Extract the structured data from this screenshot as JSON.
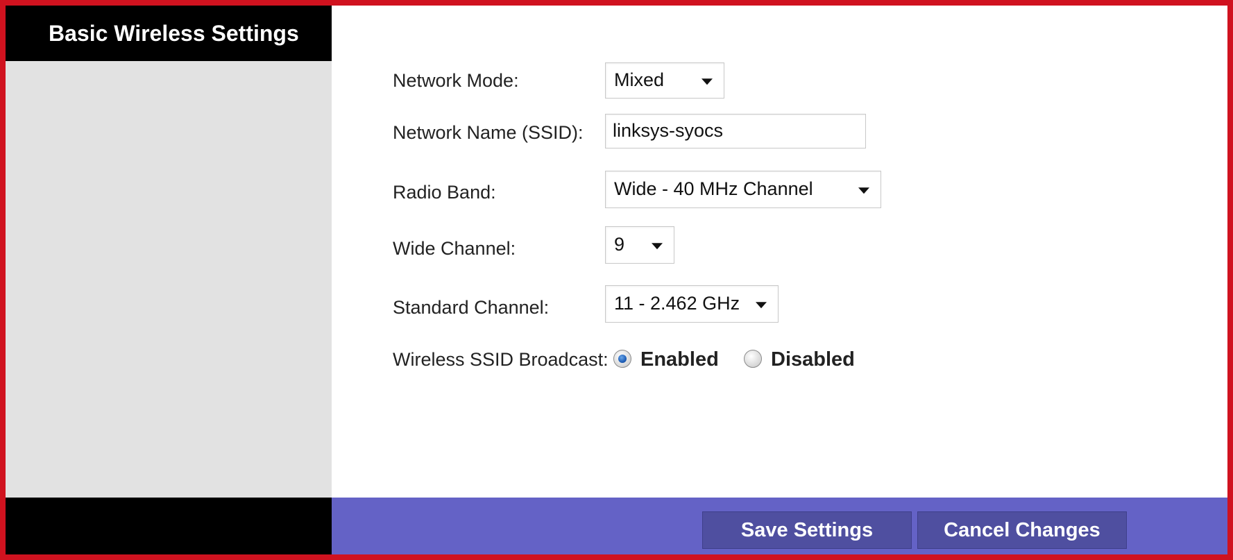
{
  "sidebar": {
    "title": "Basic Wireless Settings"
  },
  "form": {
    "network_mode": {
      "label": "Network Mode:",
      "value": "Mixed"
    },
    "ssid": {
      "label": "Network Name (SSID):",
      "value": "linksys-syocs"
    },
    "radio_band": {
      "label": "Radio Band:",
      "value": "Wide - 40 MHz Channel"
    },
    "wide_channel": {
      "label": "Wide Channel:",
      "value": "9"
    },
    "standard_channel": {
      "label": "Standard Channel:",
      "value": "11 - 2.462 GHz"
    },
    "ssid_broadcast": {
      "label": "Wireless SSID Broadcast:",
      "options": [
        "Enabled",
        "Disabled"
      ],
      "selected": "Enabled"
    }
  },
  "footer": {
    "save_label": "Save Settings",
    "cancel_label": "Cancel Changes"
  },
  "colors": {
    "frame_border": "#d0121f",
    "sidebar_bg": "#e2e2e2",
    "header_bg": "#000000",
    "footer_accent": "#6462c6",
    "button_bg": "#4f4fa0"
  }
}
